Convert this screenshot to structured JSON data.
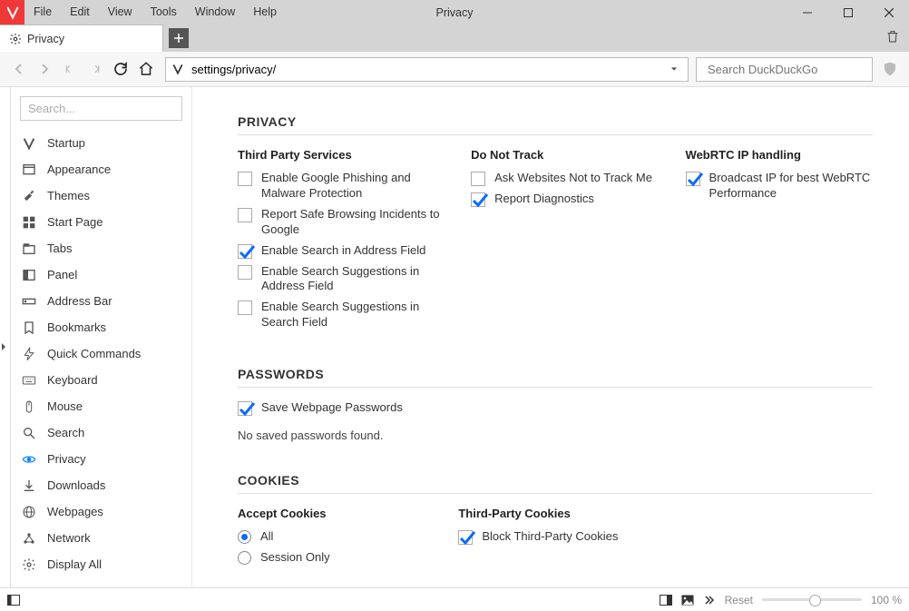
{
  "window": {
    "title": "Privacy",
    "menus": [
      "File",
      "Edit",
      "View",
      "Tools",
      "Window",
      "Help"
    ]
  },
  "tab": {
    "label": "Privacy"
  },
  "address": {
    "url": "settings/privacy/"
  },
  "search": {
    "placeholder": "Search DuckDuckGo"
  },
  "sidebar": {
    "search_placeholder": "Search...",
    "items": [
      {
        "label": "Startup",
        "icon": "v"
      },
      {
        "label": "Appearance",
        "icon": "window"
      },
      {
        "label": "Themes",
        "icon": "brush"
      },
      {
        "label": "Start Page",
        "icon": "grid"
      },
      {
        "label": "Tabs",
        "icon": "tabs"
      },
      {
        "label": "Panel",
        "icon": "panel"
      },
      {
        "label": "Address Bar",
        "icon": "addr"
      },
      {
        "label": "Bookmarks",
        "icon": "bookmark"
      },
      {
        "label": "Quick Commands",
        "icon": "quick"
      },
      {
        "label": "Keyboard",
        "icon": "keyboard"
      },
      {
        "label": "Mouse",
        "icon": "mouse"
      },
      {
        "label": "Search",
        "icon": "search"
      },
      {
        "label": "Privacy",
        "icon": "eye",
        "active": true
      },
      {
        "label": "Downloads",
        "icon": "download"
      },
      {
        "label": "Webpages",
        "icon": "globe"
      },
      {
        "label": "Network",
        "icon": "network"
      },
      {
        "label": "Display All",
        "icon": "gear"
      }
    ]
  },
  "privacy": {
    "title": "PRIVACY",
    "cols": {
      "third_party": {
        "title": "Third Party Services",
        "items": [
          {
            "label": "Enable Google Phishing and Malware Protection",
            "checked": false
          },
          {
            "label": "Report Safe Browsing Incidents to Google",
            "checked": false
          },
          {
            "label": "Enable Search in Address Field",
            "checked": true
          },
          {
            "label": "Enable Search Suggestions in Address Field",
            "checked": false
          },
          {
            "label": "Enable Search Suggestions in Search Field",
            "checked": false
          }
        ]
      },
      "dnt": {
        "title": "Do Not Track",
        "items": [
          {
            "label": "Ask Websites Not to Track Me",
            "checked": false
          },
          {
            "label": "Report Diagnostics",
            "checked": true
          }
        ]
      },
      "webrtc": {
        "title": "WebRTC IP handling",
        "items": [
          {
            "label": "Broadcast IP for best WebRTC Performance",
            "checked": true
          }
        ]
      }
    }
  },
  "passwords": {
    "title": "PASSWORDS",
    "save_label": "Save Webpage Passwords",
    "save_checked": true,
    "note": "No saved passwords found."
  },
  "cookies": {
    "title": "COOKIES",
    "accept": {
      "title": "Accept Cookies",
      "options": [
        {
          "label": "All",
          "checked": true
        },
        {
          "label": "Session Only",
          "checked": false
        }
      ]
    },
    "third_party": {
      "title": "Third-Party Cookies",
      "block_label": "Block Third-Party Cookies",
      "block_checked": true
    }
  },
  "statusbar": {
    "reset": "Reset",
    "zoom": "100 %"
  }
}
